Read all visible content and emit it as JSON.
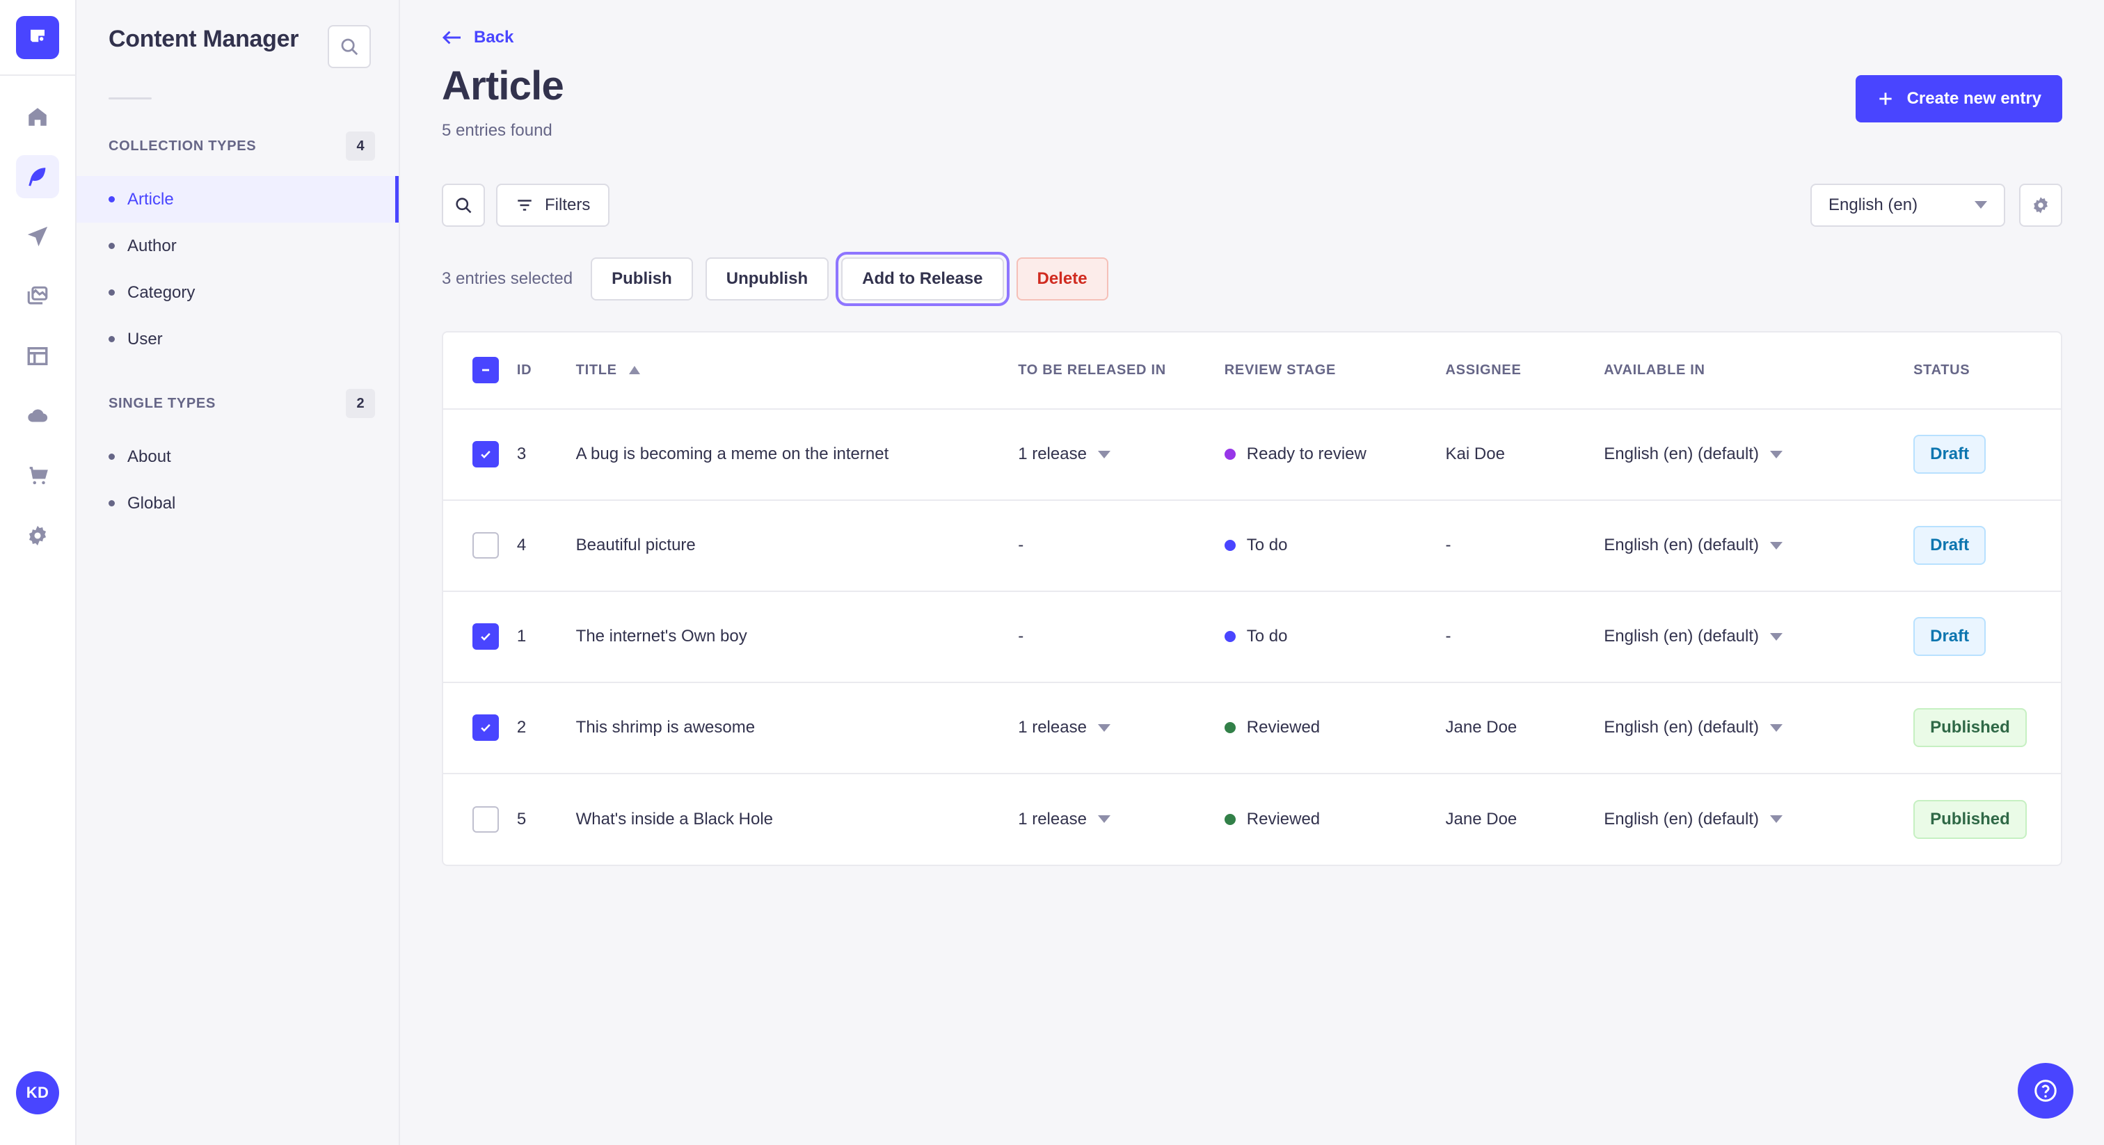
{
  "rail": {
    "logo_icon": "strapi-logo-icon",
    "items": [
      {
        "icon": "home-icon",
        "name": "home",
        "active": false
      },
      {
        "icon": "feather-content-icon",
        "name": "content-manager",
        "active": true
      },
      {
        "icon": "paper-plane-icon",
        "name": "releases",
        "active": false
      },
      {
        "icon": "media-library-icon",
        "name": "media-library",
        "active": false
      },
      {
        "icon": "content-type-builder-icon",
        "name": "content-type-builder",
        "active": false
      },
      {
        "icon": "cloud-icon",
        "name": "strapi-cloud",
        "active": false
      },
      {
        "icon": "shopping-cart-icon",
        "name": "marketplace",
        "active": false
      },
      {
        "icon": "gear-icon",
        "name": "settings",
        "active": false
      }
    ],
    "avatar_initials": "KD"
  },
  "subnav": {
    "title": "Content Manager",
    "search_icon": "search-icon",
    "groups": [
      {
        "label": "COLLECTION TYPES",
        "badge": "4",
        "items": [
          {
            "label": "Article",
            "active": true
          },
          {
            "label": "Author",
            "active": false
          },
          {
            "label": "Category",
            "active": false
          },
          {
            "label": "User",
            "active": false
          }
        ]
      },
      {
        "label": "SINGLE TYPES",
        "badge": "2",
        "items": [
          {
            "label": "About",
            "active": false
          },
          {
            "label": "Global",
            "active": false
          }
        ]
      }
    ]
  },
  "header": {
    "back_label": "Back",
    "back_icon": "arrow-left-icon",
    "title": "Article",
    "subtitle": "5 entries found",
    "create_label": "Create new entry",
    "create_icon": "plus-icon"
  },
  "toolbar": {
    "search_icon": "search-icon",
    "filters_label": "Filters",
    "filters_icon": "filter-icon",
    "locale_value": "English (en)",
    "settings_icon": "gear-icon"
  },
  "bulk": {
    "count_label": "3 entries selected",
    "publish_label": "Publish",
    "unpublish_label": "Unpublish",
    "add_release_label": "Add to Release",
    "delete_label": "Delete",
    "focused_action": "Add to Release"
  },
  "table": {
    "header_checkbox_state": "indeterminate",
    "columns": [
      "ID",
      "TITLE",
      "TO BE RELEASED IN",
      "REVIEW STAGE",
      "ASSIGNEE",
      "AVAILABLE IN",
      "STATUS"
    ],
    "sort_column": "TITLE",
    "sort_direction": "asc",
    "rows": [
      {
        "selected": true,
        "id": "3",
        "title": "A bug is becoming a meme on the internet",
        "released_in": "1 release",
        "has_release_caret": true,
        "review_stage": "Ready to review",
        "stage_color": "#9736e8",
        "assignee": "Kai Doe",
        "available_in": "English (en) (default)",
        "status": "Draft"
      },
      {
        "selected": false,
        "id": "4",
        "title": "Beautiful picture",
        "released_in": "-",
        "has_release_caret": false,
        "review_stage": "To do",
        "stage_color": "#4945ff",
        "assignee": "-",
        "available_in": "English (en) (default)",
        "status": "Draft"
      },
      {
        "selected": true,
        "id": "1",
        "title": "The internet's Own boy",
        "released_in": "-",
        "has_release_caret": false,
        "review_stage": "To do",
        "stage_color": "#4945ff",
        "assignee": "-",
        "available_in": "English (en) (default)",
        "status": "Draft"
      },
      {
        "selected": true,
        "id": "2",
        "title": "This shrimp is awesome",
        "released_in": "1 release",
        "has_release_caret": true,
        "review_stage": "Reviewed",
        "stage_color": "#328048",
        "assignee": "Jane Doe",
        "available_in": "English (en) (default)",
        "status": "Published"
      },
      {
        "selected": false,
        "id": "5",
        "title": "What's inside a Black Hole",
        "released_in": "1 release",
        "has_release_caret": true,
        "review_stage": "Reviewed",
        "stage_color": "#328048",
        "assignee": "Jane Doe",
        "available_in": "English (en) (default)",
        "status": "Published"
      }
    ]
  },
  "help": {
    "icon": "question-mark-icon"
  },
  "colors": {
    "primary": "#4945ff",
    "primary_light": "#f0f0ff",
    "text": "#32324d",
    "muted": "#666687",
    "border": "#eaeaef",
    "bg": "#f6f6f9",
    "focus_ring": "#8e75ff",
    "danger": "#d02b20",
    "draft": "#0c75af",
    "published": "#2f6846"
  }
}
